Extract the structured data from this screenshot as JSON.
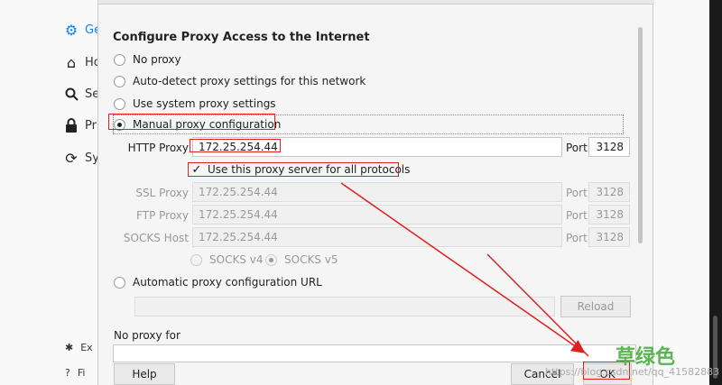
{
  "sidebar": {
    "items": [
      {
        "label": "Ge",
        "icon": "gear-icon"
      },
      {
        "label": "Ho",
        "icon": "home-icon"
      },
      {
        "label": "Se",
        "icon": "search-icon"
      },
      {
        "label": "Pr",
        "icon": "lock-icon"
      },
      {
        "label": "Sy",
        "icon": "sync-icon"
      }
    ],
    "bottom": [
      {
        "label": "Ex",
        "icon": "extensions-icon"
      },
      {
        "label": "Fi",
        "icon": "help-circle-icon"
      }
    ]
  },
  "dialog": {
    "title": "Configure Proxy Access to the Internet",
    "options": {
      "no_proxy": "No proxy",
      "auto_detect": "Auto-detect proxy settings for this network",
      "system": "Use system proxy settings",
      "manual": "Manual proxy configuration",
      "auto_url": "Automatic proxy configuration URL"
    },
    "http": {
      "label": "HTTP Proxy",
      "value": "172.25.254.44",
      "port_label": "Port",
      "port": "3128"
    },
    "use_all": "Use this proxy server for all protocols",
    "ssl": {
      "label": "SSL Proxy",
      "value": "172.25.254.44",
      "port_label": "Port",
      "port": "3128"
    },
    "ftp": {
      "label": "FTP Proxy",
      "value": "172.25.254.44",
      "port_label": "Port",
      "port": "3128"
    },
    "socks": {
      "label": "SOCKS Host",
      "value": "172.25.254.44",
      "port_label": "Port",
      "port": "3128"
    },
    "socks_v4": "SOCKS v4",
    "socks_v5": "SOCKS v5",
    "reload": "Reload",
    "no_proxy_for": "No proxy for",
    "help": "Help",
    "cancel": "Cancel",
    "ok": "OK"
  },
  "watermark": {
    "text": "草绿色",
    "url": "https://blog.csdn.net/qq_41582883"
  }
}
